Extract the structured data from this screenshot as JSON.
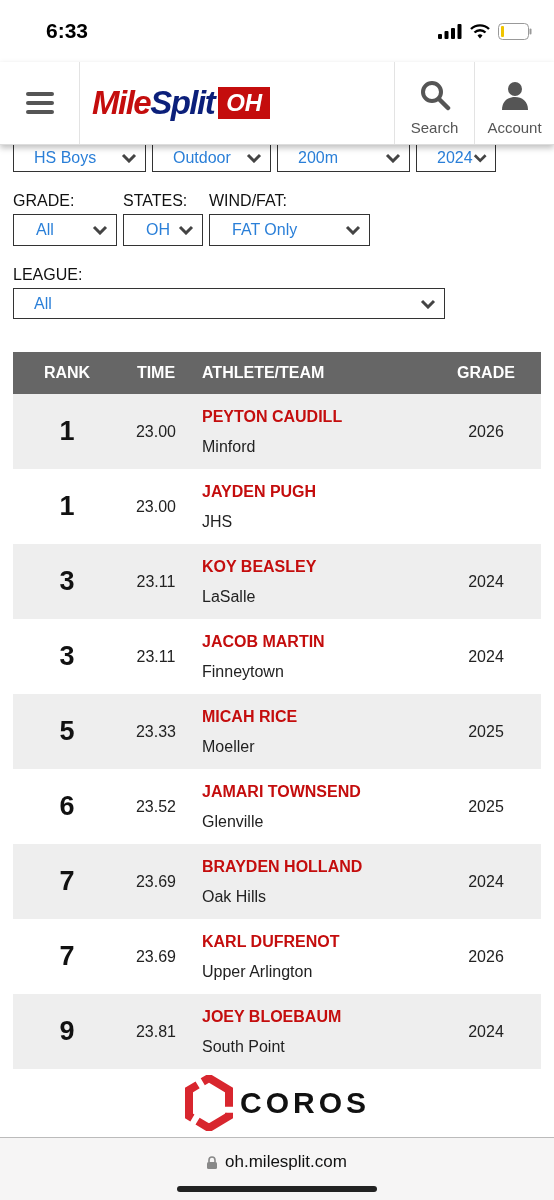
{
  "status_bar": {
    "time": "6:33"
  },
  "header": {
    "logo": {
      "part_1": "Mile",
      "part_2": "Split",
      "badge": "OH"
    },
    "actions": [
      {
        "label": "Search",
        "kind": "search"
      },
      {
        "label": "Account",
        "kind": "account"
      }
    ]
  },
  "filters": {
    "top_row": [
      {
        "value": "HS Boys"
      },
      {
        "value": "Outdoor"
      },
      {
        "value": "200m"
      },
      {
        "value": "2024"
      }
    ],
    "labeled": [
      {
        "label": "GRADE:",
        "value": "All"
      },
      {
        "label": "STATES:",
        "value": "OH"
      },
      {
        "label": "WIND/FAT:",
        "value": "FAT Only"
      }
    ],
    "league": {
      "label": "LEAGUE:",
      "value": "All"
    }
  },
  "table": {
    "columns": [
      "RANK",
      "TIME",
      "ATHLETE/TEAM",
      "GRADE"
    ],
    "rows": [
      {
        "rank": "1",
        "time": "23.00",
        "athlete": "PEYTON CAUDILL",
        "team": "Minford",
        "grade": "2026"
      },
      {
        "rank": "1",
        "time": "23.00",
        "athlete": "JAYDEN PUGH",
        "team": "JHS"
      },
      {
        "rank": "3",
        "time": "23.11",
        "athlete": "KOY BEASLEY",
        "team": "LaSalle",
        "grade": "2024"
      },
      {
        "rank": "3",
        "time": "23.11",
        "athlete": "JACOB MARTIN",
        "team": "Finneytown",
        "grade": "2024"
      },
      {
        "rank": "5",
        "time": "23.33",
        "athlete": "MICAH RICE",
        "team": "Moeller",
        "grade": "2025"
      },
      {
        "rank": "6",
        "time": "23.52",
        "athlete": "JAMARI TOWNSEND",
        "team": "Glenville",
        "grade": "2025"
      },
      {
        "rank": "7",
        "time": "23.69",
        "athlete": "BRAYDEN HOLLAND",
        "team": "Oak Hills",
        "grade": "2024"
      },
      {
        "rank": "7",
        "time": "23.69",
        "athlete": "KARL DUFRENOT",
        "team": "Upper Arlington",
        "grade": "2026"
      },
      {
        "rank": "9",
        "time": "23.81",
        "athlete": "JOEY BLOEBAUM",
        "team": "South Point",
        "grade": "2024"
      }
    ]
  },
  "sponsor": {
    "name": "COROS"
  },
  "browser": {
    "url": "oh.milesplit.com"
  }
}
